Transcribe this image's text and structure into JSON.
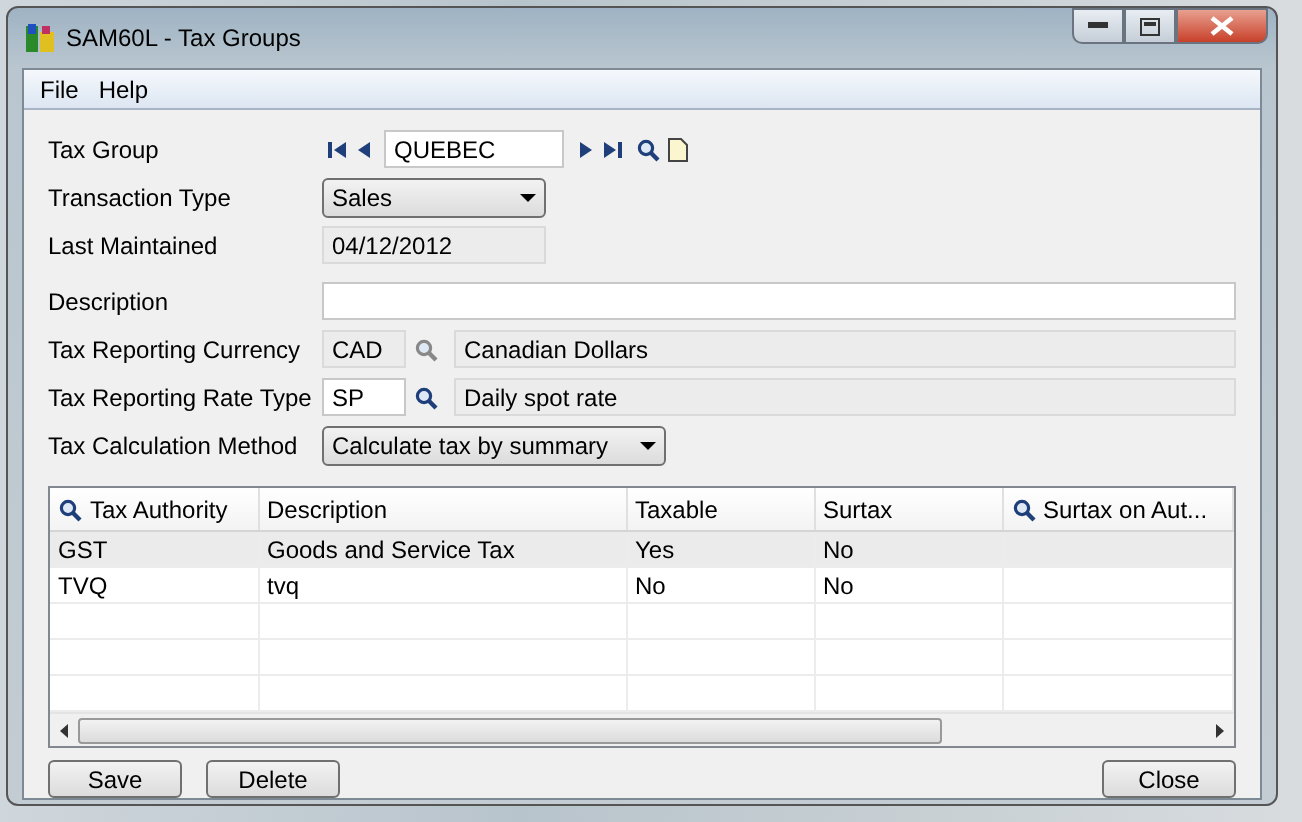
{
  "window": {
    "title": "SAM60L - Tax Groups"
  },
  "menu": [
    "File",
    "Help"
  ],
  "form": {
    "tax_group": {
      "label": "Tax Group",
      "value": "QUEBEC"
    },
    "transaction_type": {
      "label": "Transaction Type",
      "value": "Sales"
    },
    "last_maintained": {
      "label": "Last Maintained",
      "value": "04/12/2012"
    },
    "description": {
      "label": "Description"
    },
    "currency": {
      "label": "Tax Reporting Currency",
      "code": "CAD",
      "name": "Canadian Dollars"
    },
    "rate_type": {
      "label": "Tax Reporting Rate Type",
      "code": "SP",
      "name": "Daily spot rate"
    },
    "calc_method": {
      "label": "Tax Calculation Method",
      "value": "Calculate tax by summary"
    }
  },
  "table": {
    "columns": [
      {
        "label": "Tax Authority",
        "finder": true
      },
      {
        "label": "Description",
        "finder": false
      },
      {
        "label": "Taxable",
        "finder": false
      },
      {
        "label": "Surtax",
        "finder": false
      },
      {
        "label": "Surtax on Aut...",
        "finder": true
      }
    ],
    "rows": [
      {
        "cells": [
          "GST",
          "Goods and Service Tax",
          "Yes",
          "No",
          ""
        ],
        "selected": true
      },
      {
        "cells": [
          "TVQ",
          "tvq",
          "No",
          "No",
          ""
        ],
        "selected": false
      }
    ]
  },
  "buttons": [
    {
      "label": "Save",
      "kind": "left"
    },
    {
      "label": "Delete",
      "kind": "left"
    },
    {
      "label": "Close",
      "kind": "right"
    }
  ]
}
